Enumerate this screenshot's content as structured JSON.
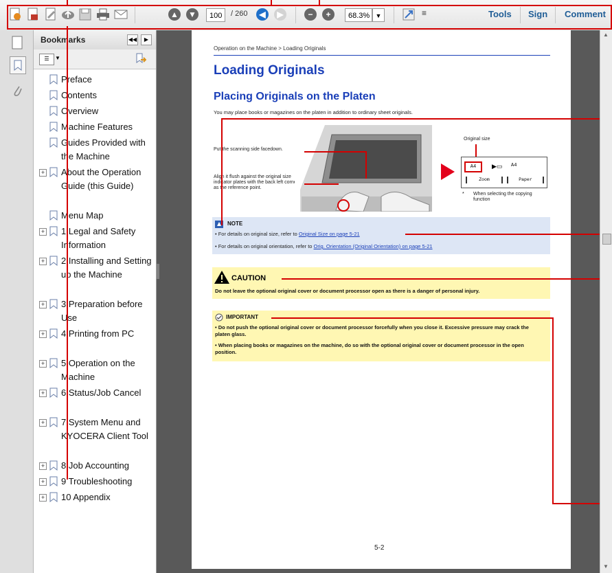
{
  "toolbar": {
    "page_current": "100",
    "page_total": "/ 260",
    "zoom": "68.3%",
    "tools_label": "Tools",
    "sign_label": "Sign",
    "comment_label": "Comment"
  },
  "bookmarks_panel": {
    "title": "Bookmarks",
    "items": [
      {
        "label": "Preface",
        "expandable": false
      },
      {
        "label": "Contents",
        "expandable": false
      },
      {
        "label": "Overview",
        "expandable": false
      },
      {
        "label": "Machine Features",
        "expandable": false
      },
      {
        "label": "Guides Provided with the Machine",
        "expandable": false
      },
      {
        "label": "About the Operation Guide (this Guide)",
        "expandable": true
      },
      {
        "label": "Menu Map",
        "expandable": false
      },
      {
        "label": "1 Legal and Safety Information",
        "expandable": true
      },
      {
        "label": "2 Installing and Setting up the Machine",
        "expandable": true
      },
      {
        "label": "3 Preparation before Use",
        "expandable": true
      },
      {
        "label": "4 Printing from PC",
        "expandable": true
      },
      {
        "label": "5 Operation on the Machine",
        "expandable": true
      },
      {
        "label": "6 Status/Job Cancel",
        "expandable": true
      },
      {
        "label": "7 System Menu and KYOCERA Client Tool",
        "expandable": true
      },
      {
        "label": "8 Job Accounting",
        "expandable": true
      },
      {
        "label": "9 Troubleshooting",
        "expandable": true
      },
      {
        "label": "10 Appendix",
        "expandable": true
      }
    ]
  },
  "document": {
    "breadcrumb": "Operation on the Machine > Loading Originals",
    "title": "Loading Originals",
    "subtitle": "Placing Originals on the Platen",
    "intro": "You may place books or magazines on the platen in addition to ordinary sheet originals.",
    "fig_label_1": "Put the scanning side facedown.",
    "fig_label_2": "Align it flush against the original size indicator plates with the back left corner as the reference point.",
    "original_size_label": "Original size",
    "panel_a4": "A4",
    "panel_a4_right": "A4",
    "panel_zoom": "Zoom",
    "panel_paper": "Paper",
    "footnote_star": "*",
    "footnote": "When selecting the copying function",
    "note": {
      "heading": "NOTE",
      "line1_prefix": "For details on original size, refer to ",
      "line1_link": "Original Size on page 5-21",
      "line2_prefix": "For details on original orientation, refer to ",
      "line2_link": "Orig. Orientation (Original Orientation) on page 5-21"
    },
    "caution": {
      "heading": "CAUTION",
      "text": "Do not leave the optional original cover or document processor open as there is a danger of personal injury."
    },
    "important": {
      "heading": "IMPORTANT",
      "bullet1": "Do not push the optional original cover or document processor forcefully when you close it. Excessive pressure may crack the platen glass.",
      "bullet2": "When placing books or magazines on the machine, do so with the optional original cover or document processor in the open position."
    },
    "page_number": "5-2"
  },
  "colors": {
    "accent_blue": "#1a3fb8",
    "callout_red": "#d40000",
    "note_bg": "#dde6f5",
    "caution_bg": "#fff7b3"
  }
}
